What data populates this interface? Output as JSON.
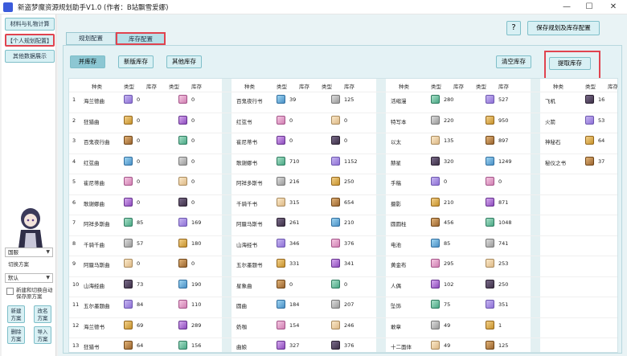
{
  "window": {
    "title": "新盗梦魔资源规划助手V1.0 (作者：B站飘雪爱娜)",
    "min": "—",
    "max": "☐",
    "close": "✕"
  },
  "left": {
    "calc": "材料与礼物计算",
    "personal": "【个人规划配置】",
    "other": "其他数据展示",
    "region": "国服",
    "switch_label": "切换方案",
    "scheme": "默认",
    "auto_label": "新建和切换自动保存原方案",
    "new": "新建\n方案",
    "rename": "改名\n方案",
    "delete": "删除\n方案",
    "import": "导入\n方案"
  },
  "tabs": {
    "plan": "规划配置",
    "inv": "库存配置"
  },
  "top": {
    "help": "?",
    "save_cfg": "保存规划及库存配置"
  },
  "toolbar": {
    "merge": "并库存",
    "new_inv": "新版库存",
    "other_inv": "其他库存",
    "clear": "清空库存",
    "read": "提取库存"
  },
  "headers": {
    "kind": "种类",
    "type": "类型",
    "stock": "库存"
  },
  "columns": [
    {
      "rows": [
        {
          "num": "1",
          "name": "海兰德曲",
          "a": "0",
          "b": "0"
        },
        {
          "num": "2",
          "name": "狂猎曲",
          "a": "0",
          "b": "0"
        },
        {
          "num": "3",
          "name": "百鬼夜行曲",
          "a": "0",
          "b": "0"
        },
        {
          "num": "4",
          "name": "红弦曲",
          "a": "0",
          "b": "0"
        },
        {
          "num": "5",
          "name": "崔尼蒂曲",
          "a": "0",
          "b": "0"
        },
        {
          "num": "6",
          "name": "歌谢娜曲",
          "a": "0",
          "b": "0"
        },
        {
          "num": "7",
          "name": "阿祥多斯曲",
          "a": "85",
          "b": "169"
        },
        {
          "num": "8",
          "name": "千骑千曲",
          "a": "57",
          "b": "180"
        },
        {
          "num": "9",
          "name": "阿蜃马斯曲",
          "a": "0",
          "b": "0"
        },
        {
          "num": "10",
          "name": "山海经曲",
          "a": "73",
          "b": "190"
        },
        {
          "num": "11",
          "name": "五尔墨题曲",
          "a": "84",
          "b": "110"
        },
        {
          "num": "12",
          "name": "海兰德书",
          "a": "69",
          "b": "289"
        },
        {
          "num": "13",
          "name": "狂猎书",
          "a": "64",
          "b": "156"
        }
      ]
    },
    {
      "rows": [
        {
          "name": "百鬼夜行书",
          "a": "39",
          "b": "125"
        },
        {
          "name": "红弦书",
          "a": "0",
          "b": "0"
        },
        {
          "name": "崔尼蒂书",
          "a": "0",
          "b": "0"
        },
        {
          "name": "歌谢娜书",
          "a": "710",
          "b": "1152"
        },
        {
          "name": "阿祥多斯书",
          "a": "216",
          "b": "250"
        },
        {
          "name": "千骑千书",
          "a": "315",
          "b": "654"
        },
        {
          "name": "阿蜃马斯书",
          "a": "261",
          "b": "210"
        },
        {
          "name": "山海经书",
          "a": "346",
          "b": "376"
        },
        {
          "name": "五尔墨题书",
          "a": "331",
          "b": "341"
        },
        {
          "name": "星象曲",
          "a": "0",
          "b": "0"
        },
        {
          "name": "圆曲",
          "a": "184",
          "b": "207"
        },
        {
          "name": "奶咖",
          "a": "154",
          "b": "246"
        },
        {
          "name": "曲娘",
          "a": "327",
          "b": "376"
        }
      ]
    },
    {
      "rows": [
        {
          "name": "活缩漫",
          "a": "280",
          "b": "527"
        },
        {
          "name": "特写本",
          "a": "220",
          "b": "950"
        },
        {
          "name": "以太",
          "a": "135",
          "b": "897"
        },
        {
          "name": "赫星",
          "a": "320",
          "b": "1249"
        },
        {
          "name": "手稿",
          "a": "0",
          "b": "0"
        },
        {
          "name": "摄影",
          "a": "210",
          "b": "871"
        },
        {
          "name": "圆圆柱",
          "a": "456",
          "b": "1048"
        },
        {
          "name": "电池",
          "a": "85",
          "b": "741"
        },
        {
          "name": "黄金布",
          "a": "295",
          "b": "253"
        },
        {
          "name": "人偶",
          "a": "102",
          "b": "250"
        },
        {
          "name": "坠饰",
          "a": "75",
          "b": "351"
        },
        {
          "name": "敢章",
          "a": "49",
          "b": "1"
        },
        {
          "name": "十二面体",
          "a": "49",
          "b": "125"
        }
      ]
    },
    {
      "rows": [
        {
          "name": "飞机",
          "a": "16"
        },
        {
          "name": "火箭",
          "a": "53"
        },
        {
          "name": "神秘石",
          "a": "64"
        },
        {
          "name": "秘仪之书",
          "a": "37"
        }
      ]
    }
  ]
}
